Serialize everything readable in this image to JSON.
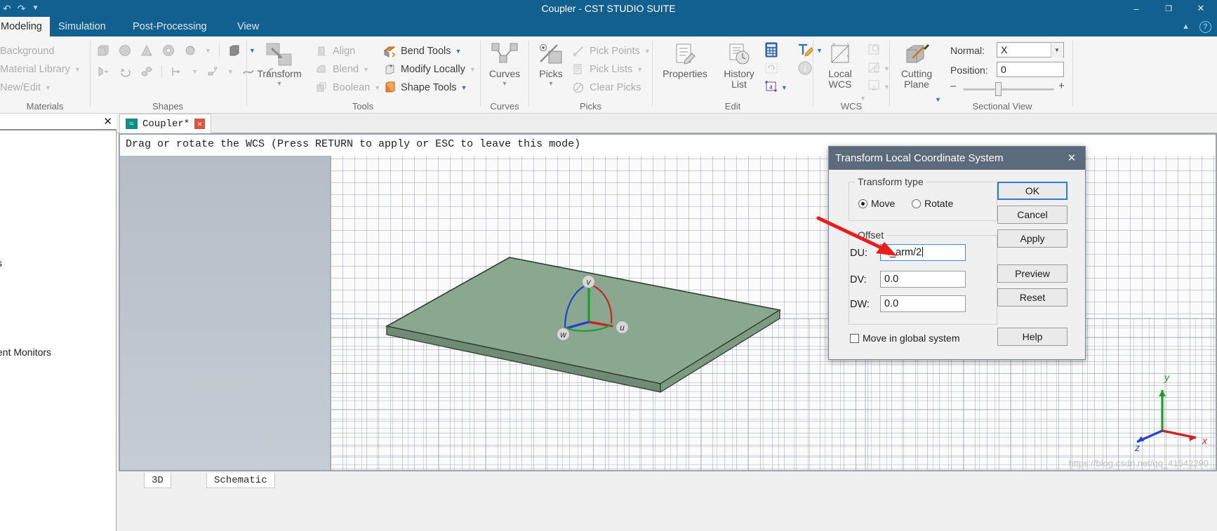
{
  "window": {
    "title": "Coupler - CST STUDIO SUITE",
    "quick_access": [
      "undo-icon",
      "redo-icon",
      "customize-icon"
    ],
    "minimize": "–",
    "restore": "❐",
    "close": "✕"
  },
  "ribbon": {
    "tabs": [
      {
        "label": "Modeling",
        "active": true
      },
      {
        "label": "Simulation",
        "active": false
      },
      {
        "label": "Post-Processing",
        "active": false
      },
      {
        "label": "View",
        "active": false
      }
    ],
    "collapse_icon": "chevron-up-icon",
    "help_icon": "?",
    "groups": [
      {
        "name": "Materials",
        "label": "Materials",
        "items": [
          {
            "label": "Background",
            "enabled": false,
            "caret": false
          },
          {
            "label": "Material Library",
            "enabled": false,
            "caret": true
          },
          {
            "label": "New/Edit",
            "enabled": false,
            "caret": true
          }
        ]
      },
      {
        "name": "Shapes",
        "label": "Shapes",
        "icons_row1": [
          "brick-icon",
          "sphere-icon",
          "cone-icon",
          "cylinder-icon",
          "torus-icon",
          "extrude-icon"
        ],
        "icons_row2": [
          "extrude-curve-icon",
          "rotate-icon",
          "loft-icon",
          "trace-icon",
          "wire-icon",
          "curve-icon",
          "bend-icon"
        ]
      },
      {
        "name": "Tools",
        "label": "Tools",
        "big": {
          "label": "Transform",
          "caret": true,
          "icon": "transform-icon"
        },
        "items": [
          {
            "label": "Align",
            "enabled": false,
            "caret": false,
            "icon": "align-icon"
          },
          {
            "label": "Blend",
            "enabled": false,
            "caret": true,
            "icon": "blend-icon"
          },
          {
            "label": "Boolean",
            "enabled": false,
            "caret": true,
            "icon": "boolean-icon"
          },
          {
            "label": "Bend Tools",
            "enabled": true,
            "caret": true,
            "icon": "bend-tools-icon"
          },
          {
            "label": "Modify Locally",
            "enabled": true,
            "caret": true,
            "icon": "modify-locally-icon"
          },
          {
            "label": "Shape Tools",
            "enabled": true,
            "caret": true,
            "icon": "shape-tools-icon"
          }
        ]
      },
      {
        "name": "Curves",
        "label": "Curves",
        "big": {
          "label": "Curves",
          "caret": true,
          "icon": "curves-icon"
        }
      },
      {
        "name": "Picks",
        "label": "Picks",
        "big": {
          "label": "Picks",
          "caret": true,
          "icon": "picks-icon"
        },
        "items": [
          {
            "label": "Pick Points",
            "enabled": false,
            "caret": true,
            "icon": "pick-points-icon"
          },
          {
            "label": "Pick Lists",
            "enabled": false,
            "caret": true,
            "icon": "pick-lists-icon"
          },
          {
            "label": "Clear Picks",
            "enabled": false,
            "caret": false,
            "icon": "clear-picks-icon"
          }
        ]
      },
      {
        "name": "Edit",
        "label": "Edit",
        "big1": {
          "label": "Properties",
          "icon": "properties-icon"
        },
        "big2": {
          "label": "History List",
          "icon": "history-list-icon"
        },
        "small_icons": [
          "calculator-icon",
          "parametric-update-icon",
          "parameter-icon",
          "text-edit-icon",
          "info-icon"
        ]
      },
      {
        "name": "WCS",
        "label": "WCS",
        "big": {
          "label": "Local WCS",
          "caret": true,
          "icon": "local-wcs-icon"
        },
        "small_icons": [
          "align-wcs-icon",
          "wcs-properties-icon",
          "wcs-store-icon"
        ]
      },
      {
        "name": "SectionalView",
        "label": "Sectional View",
        "big": {
          "label": "Cutting Plane",
          "caret": true,
          "icon": "cutting-plane-icon"
        },
        "normal_label": "Normal:",
        "normal_value": "X",
        "position_label": "Position:",
        "position_value": "0",
        "slider_minus": "–",
        "slider_plus": "+"
      }
    ]
  },
  "left_panel": {
    "close_icon": "✕",
    "tree_fragments": [
      {
        "text": "s",
        "blue": false
      },
      {
        "text": "",
        "blue": true
      },
      {
        "text": "ent Monitors",
        "blue": false
      }
    ]
  },
  "doc_tab": {
    "icon": "project-wave-icon",
    "label": "Coupler*",
    "close": "✕"
  },
  "viewport": {
    "status_text": "Drag or rotate the WCS (Press RETURN to apply or ESC to leave this mode)",
    "wcs_axes": [
      {
        "label": "v",
        "color": "#1f9e2e"
      },
      {
        "label": "u",
        "color": "#cc2222"
      },
      {
        "label": "w",
        "color": "#2244cc"
      }
    ],
    "gizmo_axes": [
      {
        "label": "y",
        "color": "#1f9e2e"
      },
      {
        "label": "x",
        "color": "#cc2222"
      },
      {
        "label": "z",
        "color": "#2244cc"
      }
    ],
    "watermark": "https://blog.csdn.net/qq_41542290"
  },
  "bottom_tabs": [
    {
      "label": "3D",
      "active": false
    },
    {
      "label": "Schematic",
      "active": false
    }
  ],
  "dialog": {
    "title": "Transform Local Coordinate System",
    "close": "✕",
    "transform_type": {
      "group_label": "Transform type",
      "options": [
        {
          "label": "Move",
          "selected": true
        },
        {
          "label": "Rotate",
          "selected": false
        }
      ]
    },
    "offset": {
      "group_label": "Offset",
      "fields": [
        {
          "label": "DU:",
          "value": "-l_arm/2",
          "focused": true
        },
        {
          "label": "DV:",
          "value": "0.0",
          "focused": false
        },
        {
          "label": "DW:",
          "value": "0.0",
          "focused": false
        }
      ]
    },
    "checkbox": {
      "label": "Move in global system",
      "checked": false
    },
    "buttons": [
      {
        "label": "OK",
        "default": true
      },
      {
        "label": "Cancel",
        "default": false
      },
      {
        "label": "Apply",
        "default": false
      },
      {
        "label": "Preview",
        "default": false
      },
      {
        "label": "Reset",
        "default": false
      },
      {
        "label": "Help",
        "default": false
      }
    ]
  },
  "colors": {
    "titlebar": "#11608f",
    "dialog_titlebar": "#5b6b7c",
    "accent_focus": "#3a8fd4",
    "plate_green": "#7f9e84",
    "annotation_red": "#ee1b1b"
  }
}
